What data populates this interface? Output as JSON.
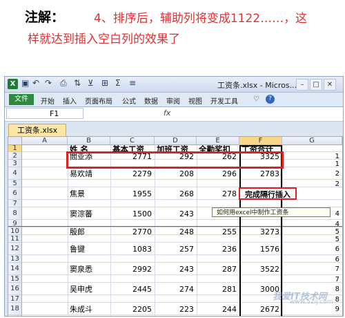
{
  "note": {
    "label": "注解：",
    "line1": "4、排序后，辅助列将变成1122……，这",
    "line2": "样就达到插入空白列的效果了"
  },
  "window": {
    "title": "工资条.xlsx - Micros...",
    "icons": [
      "excel-icon",
      "save-icon",
      "undo-icon",
      "redo-icon",
      "minimize-icon",
      "restore-icon",
      "close-icon"
    ]
  },
  "ribbon": {
    "tabs": [
      "文件",
      "开始",
      "插入",
      "页面布局",
      "公式",
      "数据",
      "审阅",
      "视图",
      "开发工具"
    ]
  },
  "formula_bar": {
    "name_box": "F1",
    "fx": "fx"
  },
  "workbook_tab": "工资条.xlsx",
  "sheet": {
    "columns": [
      "A",
      "B",
      "C",
      "D",
      "E",
      "F",
      "G"
    ],
    "row_numbers": [
      "1",
      "2",
      "3",
      "4",
      "5",
      "6",
      "7",
      "8",
      "9",
      "10",
      "11",
      "12",
      "13",
      "14",
      "15",
      "16",
      "17",
      "18",
      "19"
    ],
    "headers": [
      "姓 名",
      "基本工资",
      "加班工资",
      "全勤奖扣",
      "工资合计"
    ],
    "rows": [
      {
        "row": 2,
        "name": "閻亚添",
        "b": "2771",
        "c": "292",
        "d": "262",
        "e": "3325",
        "f": "1"
      },
      {
        "row": 3,
        "f": "1"
      },
      {
        "row": 4,
        "name": "易欢靖",
        "b": "2279",
        "c": "208",
        "d": "296",
        "e": "2783",
        "f": "2"
      },
      {
        "row": 5,
        "f": "2"
      },
      {
        "row": 6,
        "name": "焦景",
        "b": "1955",
        "c": "268",
        "d": "278",
        "e": "",
        "f": ""
      },
      {
        "row": 7,
        "f": ""
      },
      {
        "row": 8,
        "name": "窦淙蕃",
        "b": "1500",
        "c": "243",
        "d": "294",
        "e": "2037",
        "f": "4"
      },
      {
        "row": 9,
        "f": "4"
      },
      {
        "row": 10,
        "name": "殷郎",
        "b": "2770",
        "c": "248",
        "d": "255",
        "e": "3273",
        "f": "5"
      },
      {
        "row": 11,
        "f": "5"
      },
      {
        "row": 12,
        "name": "鲁键",
        "b": "1083",
        "c": "257",
        "d": "236",
        "e": "1576",
        "f": "6"
      },
      {
        "row": 13,
        "f": "6"
      },
      {
        "row": 14,
        "name": "窦泉悉",
        "b": "2992",
        "c": "243",
        "d": "287",
        "e": "3522",
        "f": "7"
      },
      {
        "row": 15,
        "f": "7"
      },
      {
        "row": 16,
        "name": "吴申虎",
        "b": "2445",
        "c": "274",
        "d": "281",
        "e": "3000",
        "f": "8"
      },
      {
        "row": 17,
        "f": "8"
      },
      {
        "row": 18,
        "name": "朱成斗",
        "b": "2205",
        "c": "223",
        "d": "244",
        "e": "2672",
        "f": "9"
      },
      {
        "row": 19,
        "f": "9"
      }
    ]
  },
  "callout": "完成隔行插入",
  "tooltip": "如何用excel中制作工资条",
  "watermark": {
    "text": "我爱IT技术网",
    "url": "www.52ij.com"
  }
}
